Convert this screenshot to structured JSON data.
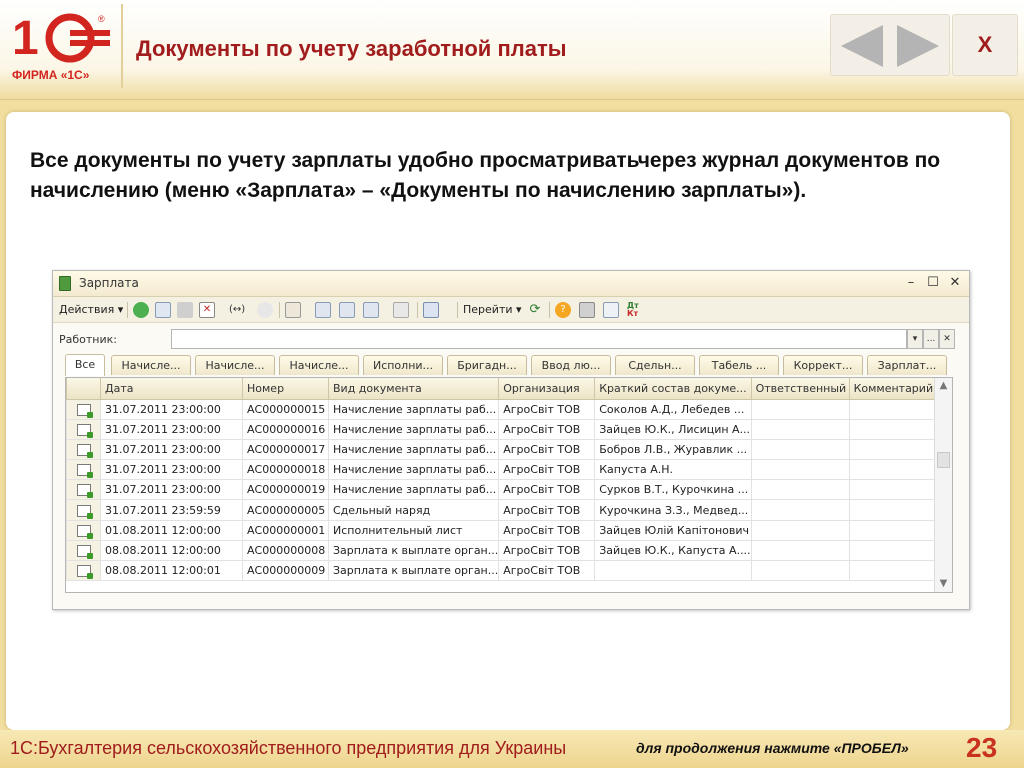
{
  "header": {
    "logo_text": "ФИРМА «1С»",
    "title": "Документы по учету заработной платы",
    "close_label": "X",
    "colors": {
      "brand": "#d3251f",
      "title": "#a11c1c",
      "nav_arrow": "#b4b4b4"
    }
  },
  "content": {
    "paragraph": "Все документы по учету зарплаты удобно просматриватьчерез журнал документов по начислению (меню «Зарплата» – «Документы по начислению зарплаты»)."
  },
  "window": {
    "title": "Зарплата",
    "controls": {
      "minimize": "–",
      "maximize": "☐",
      "close": "✕"
    },
    "toolbar": {
      "actions_label": "Действия ▾",
      "goto_label": "Перейти ▾",
      "icons": [
        "add-icon",
        "copy-icon",
        "edit-icon",
        "delete-icon",
        "post-icon",
        "find-icon",
        "filter-icon",
        "sort-icon",
        "refresh-icon",
        "help-icon",
        "print-icon",
        "preview-icon",
        "journal-icon"
      ]
    },
    "worker": {
      "label": "Работник:",
      "value": "",
      "dropdown": "▾",
      "select": "...",
      "clear": "✕"
    },
    "tabs": [
      "Все",
      "Начисле...",
      "Начисле...",
      "Начисле...",
      "Исполни...",
      "Бригадн...",
      "Ввод лю...",
      "Сдельн...",
      "Табель ...",
      "Коррект...",
      "Зарплат..."
    ],
    "columns": [
      "Дата",
      "Номер",
      "Вид документа",
      "Организация",
      "Краткий состав докуме...",
      "Ответственный",
      "Комментарий"
    ],
    "rows": [
      [
        "31.07.2011 23:00:00",
        "АС000000015",
        "Начисление зарплаты раб...",
        "АгроСвіт ТОВ",
        "Соколов А.Д., Лебедев ...",
        "",
        ""
      ],
      [
        "31.07.2011 23:00:00",
        "АС000000016",
        "Начисление зарплаты раб...",
        "АгроСвіт ТОВ",
        "Зайцев Ю.К., Лисицин А...",
        "",
        ""
      ],
      [
        "31.07.2011 23:00:00",
        "АС000000017",
        "Начисление зарплаты раб...",
        "АгроСвіт ТОВ",
        "Бобров Л.В., Журавлик ...",
        "",
        ""
      ],
      [
        "31.07.2011 23:00:00",
        "АС000000018",
        "Начисление зарплаты раб...",
        "АгроСвіт ТОВ",
        "Капуста А.Н.",
        "",
        ""
      ],
      [
        "31.07.2011 23:00:00",
        "АС000000019",
        "Начисление зарплаты раб...",
        "АгроСвіт ТОВ",
        "Сурков В.Т., Курочкина ...",
        "",
        ""
      ],
      [
        "31.07.2011 23:59:59",
        "АС000000005",
        "Сдельный наряд",
        "АгроСвіт ТОВ",
        "Курочкина З.З., Медвед...",
        "",
        ""
      ],
      [
        "01.08.2011 12:00:00",
        "АС000000001",
        "Исполнительный лист",
        "АгроСвіт ТОВ",
        "Зайцев Юлій Капітонович",
        "",
        ""
      ],
      [
        "08.08.2011 12:00:00",
        "АС000000008",
        "Зарплата к выплате орган...",
        "АгроСвіт ТОВ",
        "Зайцев Ю.К., Капуста А....",
        "",
        ""
      ],
      [
        "08.08.2011 12:00:01",
        "АС000000009",
        "Зарплата к выплате орган...",
        "АгроСвіт ТОВ",
        "",
        "",
        ""
      ]
    ]
  },
  "footer": {
    "left": "1С:Бухгалтерия сельскохозяйственного предприятия для Украины",
    "right": "для продолжения нажмите «ПРОБЕЛ»",
    "page": "23"
  }
}
